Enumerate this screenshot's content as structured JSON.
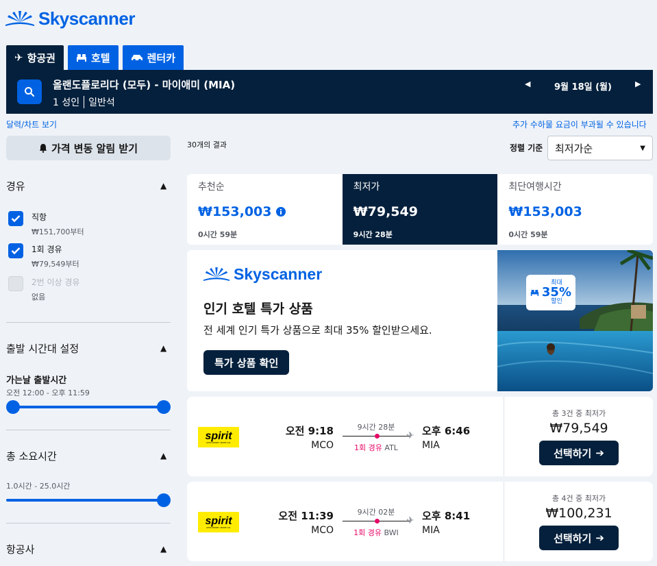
{
  "brand": {
    "name": "Skyscanner"
  },
  "tabs": [
    {
      "label": "항공권",
      "icon": "plane-icon"
    },
    {
      "label": "호텔",
      "icon": "bed-icon"
    },
    {
      "label": "렌터카",
      "icon": "car-icon"
    }
  ],
  "search": {
    "route": "올랜도플로리다 (모두) - 마이애미 (MIA)",
    "passengers": "1 성인",
    "cabin": "일반석",
    "date": "9월 18일 (월)"
  },
  "links": {
    "calendar": "달력/차트 보기",
    "fees_notice": "추가 수하물 요금이 부과될 수 있습니다"
  },
  "sidebar": {
    "price_alert": "가격 변동 알림 받기",
    "stops": {
      "title": "경유",
      "options": [
        {
          "label": "직항",
          "price": "₩151,700부터",
          "checked": true
        },
        {
          "label": "1회 경유",
          "price": "₩79,549부터",
          "checked": true
        },
        {
          "label": "2번 이상 경유",
          "price": "없음",
          "checked": false
        }
      ]
    },
    "departure": {
      "title": "출발 시간대 설정",
      "subtitle": "가는날 출발시간",
      "range": "오전 12:00 - 오후 11:59"
    },
    "duration": {
      "title": "총 소요시간",
      "range": "1.0시간 - 25.0시간"
    },
    "airlines": {
      "title": "항공사"
    }
  },
  "results": {
    "count": "30개의 결과",
    "sort_label": "정렬 기준",
    "sort_value": "최저가순"
  },
  "sort_tabs": [
    {
      "label": "추천순",
      "price": "₩153,003",
      "duration": "0시간 59분",
      "active": false
    },
    {
      "label": "최저가",
      "price": "₩79,549",
      "duration": "9시간 28분",
      "active": true
    },
    {
      "label": "최단여행시간",
      "price": "₩153,003",
      "duration": "0시간 59분",
      "active": false
    }
  ],
  "promo": {
    "brand": "Skyscanner",
    "title": "인기 호텔 특가 상품",
    "text": "전 세계 인기 특가 상품으로 최대 35% 할인받으세요.",
    "button": "특가 상품 확인",
    "badge_top": "최대",
    "badge_pct": "35%",
    "badge_bottom": "할인"
  },
  "flights": [
    {
      "airline": "spirit",
      "airline_sub": "LESS MONEY. MORE GO.",
      "dep_time": "오전 9:18",
      "dep_airport": "MCO",
      "duration": "9시간 28분",
      "stops": "1회 경유",
      "via": "ATL",
      "arr_time": "오후 6:46",
      "arr_airport": "MIA",
      "deal_caption": "총 3건 중 최저가",
      "price": "₩79,549",
      "button": "선택하기"
    },
    {
      "airline": "spirit",
      "airline_sub": "LESS MONEY. MORE GO.",
      "dep_time": "오전 11:39",
      "dep_airport": "MCO",
      "duration": "9시간 02분",
      "stops": "1회 경유",
      "via": "BWI",
      "arr_time": "오후 8:41",
      "arr_airport": "MIA",
      "deal_caption": "총 4건 중 최저가",
      "price": "₩100,231",
      "button": "선택하기"
    }
  ],
  "colors": {
    "brand_blue": "#0062e3",
    "navy": "#05203c",
    "pink": "#e70866",
    "spirit_yellow": "#ffec00"
  }
}
